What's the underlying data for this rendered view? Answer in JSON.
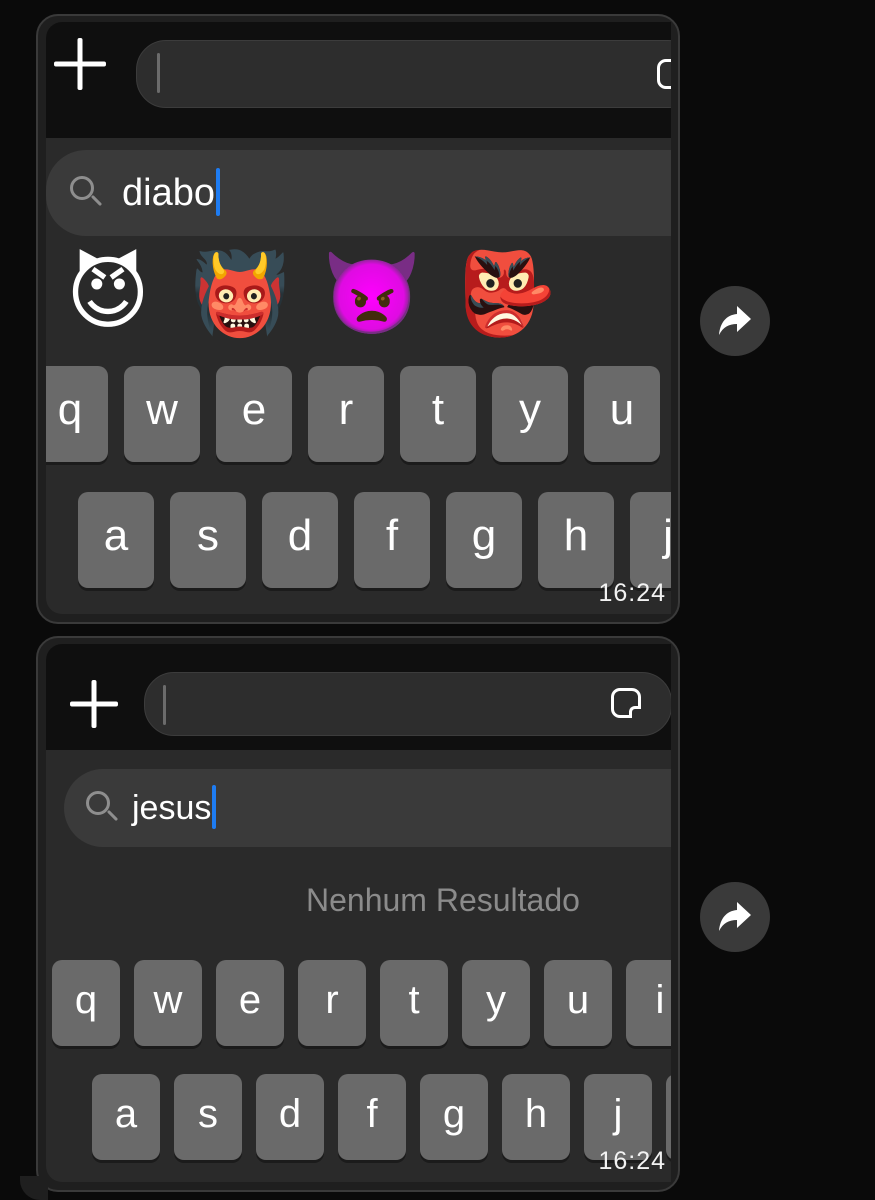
{
  "screenshot1": {
    "search": {
      "query": "diabo"
    },
    "emoji_results": [
      {
        "name": "smiling-devil",
        "glyph": "😈"
      },
      {
        "name": "ogre",
        "glyph": "👹"
      },
      {
        "name": "angry-devil",
        "glyph": "👿"
      },
      {
        "name": "goblin",
        "glyph": "👺"
      }
    ],
    "keyboard": {
      "row1": [
        "q",
        "w",
        "e",
        "r",
        "t",
        "y",
        "u"
      ],
      "row2": [
        "a",
        "s",
        "d",
        "f",
        "g",
        "h",
        "j"
      ]
    },
    "time": "16:24"
  },
  "screenshot2": {
    "search": {
      "query": "jesus"
    },
    "no_result": "Nenhum Resultado",
    "keyboard": {
      "row1": [
        "q",
        "w",
        "e",
        "r",
        "t",
        "y",
        "u",
        "i"
      ],
      "row2": [
        "a",
        "s",
        "d",
        "f",
        "g",
        "h",
        "j"
      ]
    },
    "time": "16:24"
  },
  "icons": [
    "plus-icon",
    "sticker-icon",
    "search-icon",
    "share-icon"
  ]
}
